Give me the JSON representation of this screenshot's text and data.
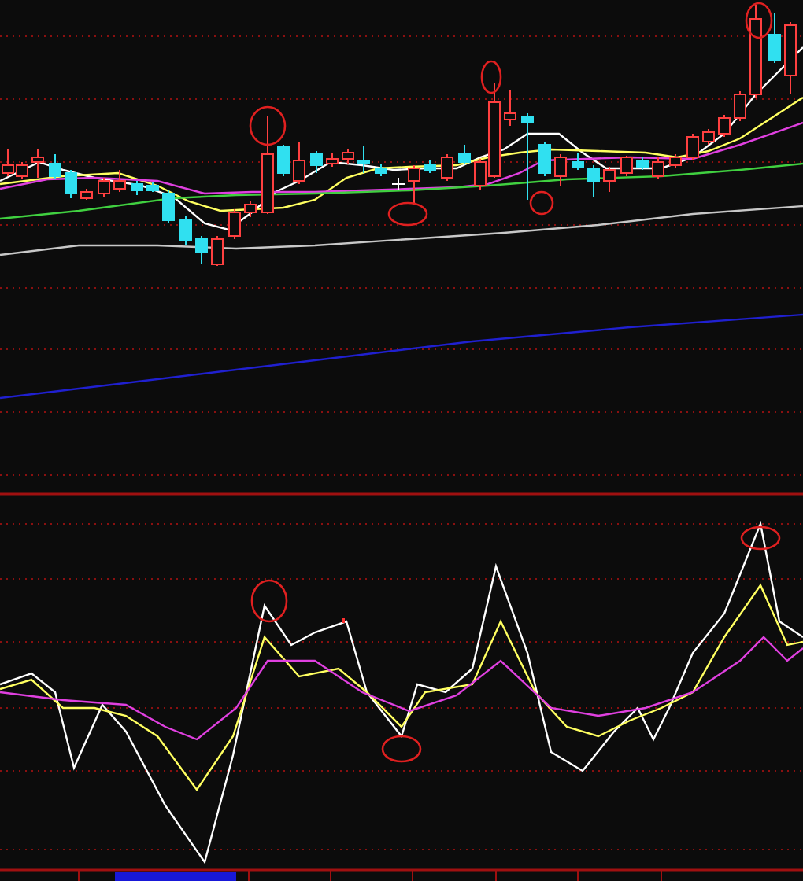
{
  "price_panel": {
    "kind": "candlestick"
  },
  "indicator_panel": {
    "kind": "lines"
  },
  "time_axis": {
    "kind": "date_axis"
  }
}
